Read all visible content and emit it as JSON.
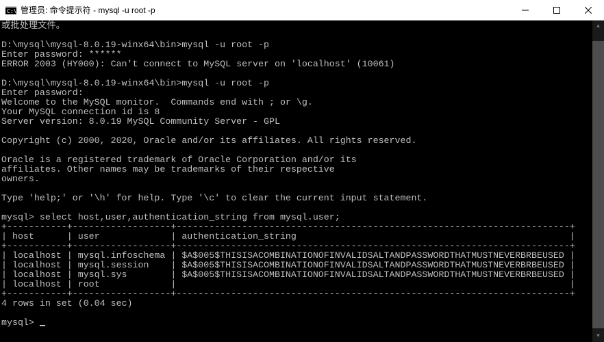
{
  "window": {
    "title": "管理员: 命令提示符 - mysql  -u root -p"
  },
  "lines": {
    "l0": "或批处理文件。",
    "l1": "",
    "l2": "D:\\mysql\\mysql-8.0.19-winx64\\bin>mysql -u root -p",
    "l3": "Enter password: ******",
    "l4": "ERROR 2003 (HY000): Can't connect to MySQL server on 'localhost' (10061)",
    "l5": "",
    "l6": "D:\\mysql\\mysql-8.0.19-winx64\\bin>mysql -u root -p",
    "l7": "Enter password:",
    "l8": "Welcome to the MySQL monitor.  Commands end with ; or \\g.",
    "l9": "Your MySQL connection id is 8",
    "l10": "Server version: 8.0.19 MySQL Community Server - GPL",
    "l11": "",
    "l12": "Copyright (c) 2000, 2020, Oracle and/or its affiliates. All rights reserved.",
    "l13": "",
    "l14": "Oracle is a registered trademark of Oracle Corporation and/or its",
    "l15": "affiliates. Other names may be trademarks of their respective",
    "l16": "owners.",
    "l17": "",
    "l18": "Type 'help;' or '\\h' for help. Type '\\c' to clear the current input statement.",
    "l19": "",
    "l20": "mysql> select host,user,authentication_string from mysql.user;",
    "l21": "+-----------+------------------+------------------------------------------------------------------------+",
    "l22": "| host      | user             | authentication_string                                                  |",
    "l23": "+-----------+------------------+------------------------------------------------------------------------+",
    "l24": "| localhost | mysql.infoschema | $A$005$THISISACOMBINATIONOFINVALIDSALTANDPASSWORDTHATMUSTNEVERBRBEUSED |",
    "l25": "| localhost | mysql.session    | $A$005$THISISACOMBINATIONOFINVALIDSALTANDPASSWORDTHATMUSTNEVERBRBEUSED |",
    "l26": "| localhost | mysql.sys        | $A$005$THISISACOMBINATIONOFINVALIDSALTANDPASSWORDTHATMUSTNEVERBRBEUSED |",
    "l27": "| localhost | root             |                                                                        |",
    "l28": "+-----------+------------------+------------------------------------------------------------------------+",
    "l29": "4 rows in set (0.04 sec)",
    "l30": "",
    "l31": "mysql> "
  },
  "table": {
    "columns": [
      "host",
      "user",
      "authentication_string"
    ],
    "rows": [
      {
        "host": "localhost",
        "user": "mysql.infoschema",
        "authentication_string": "$A$005$THISISACOMBINATIONOFINVALIDSALTANDPASSWORDTHATMUSTNEVERBRBEUSED"
      },
      {
        "host": "localhost",
        "user": "mysql.session",
        "authentication_string": "$A$005$THISISACOMBINATIONOFINVALIDSALTANDPASSWORDTHATMUSTNEVERBRBEUSED"
      },
      {
        "host": "localhost",
        "user": "mysql.sys",
        "authentication_string": "$A$005$THISISACOMBINATIONOFINVALIDSALTANDPASSWORDTHATMUSTNEVERBRBEUSED"
      },
      {
        "host": "localhost",
        "user": "root",
        "authentication_string": ""
      }
    ],
    "footer": "4 rows in set (0.04 sec)"
  },
  "prompt": "mysql> "
}
